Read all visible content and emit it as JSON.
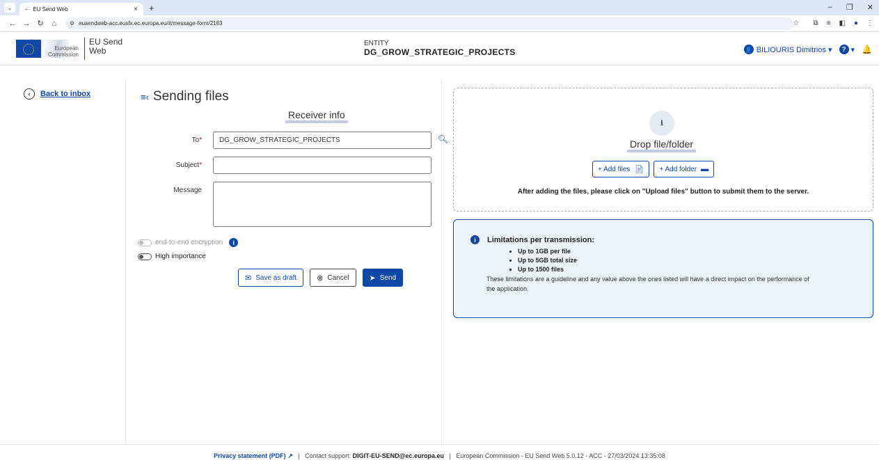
{
  "browser": {
    "tab_title": "EU Send Web",
    "url": "eusendweb-acc.eusfx.ec.europa.eu/#/message-form/2183"
  },
  "header": {
    "org_name_line1": "European",
    "org_name_line2": "Commission",
    "app_name_line1": "EU Send",
    "app_name_line2": "Web",
    "entity_label": "ENTITY",
    "entity_value": "DG_GROW_STRATEGIC_PROJECTS",
    "user_name": "BILIOURIS Dimitrios ▾",
    "help_caret": "▾"
  },
  "nav": {
    "back_label": "Back to inbox"
  },
  "form": {
    "page_title": "Sending files",
    "section_title": "Receiver info",
    "to_label": "To",
    "to_value": "DG_GROW_STRATEGIC_PROJECTS",
    "subject_label": "Subject",
    "subject_value": "",
    "message_label": "Message",
    "required_mark": "*",
    "encryption_label": "end-to-end encryption",
    "importance_label": "High importance",
    "save_draft": "Save as draft",
    "cancel": "Cancel",
    "send": "Send"
  },
  "upload": {
    "drop_title": "Drop file/folder",
    "add_files": "+ Add files",
    "add_folder": "+ Add folder",
    "note": "After adding the files, please click on \"Upload files\" button to submit them to the server."
  },
  "limits": {
    "title": "Limitations per transmission:",
    "items": [
      "Up to 1GB per file",
      "Up to 5GB total size",
      "Up to 1500 files"
    ],
    "description": "These limitations are a guideline and any value above the ones listed will have a direct impact on the performance of the application."
  },
  "footer": {
    "privacy": "Privacy statement (PDF)",
    "contact_prefix": "Contact support:",
    "contact_email": "DIGIT-EU-SEND@ec.europa.eu",
    "version_info": "European Commission - EU Send Web 5.0.12 - ACC - 27/03/2024 13:35:08"
  }
}
